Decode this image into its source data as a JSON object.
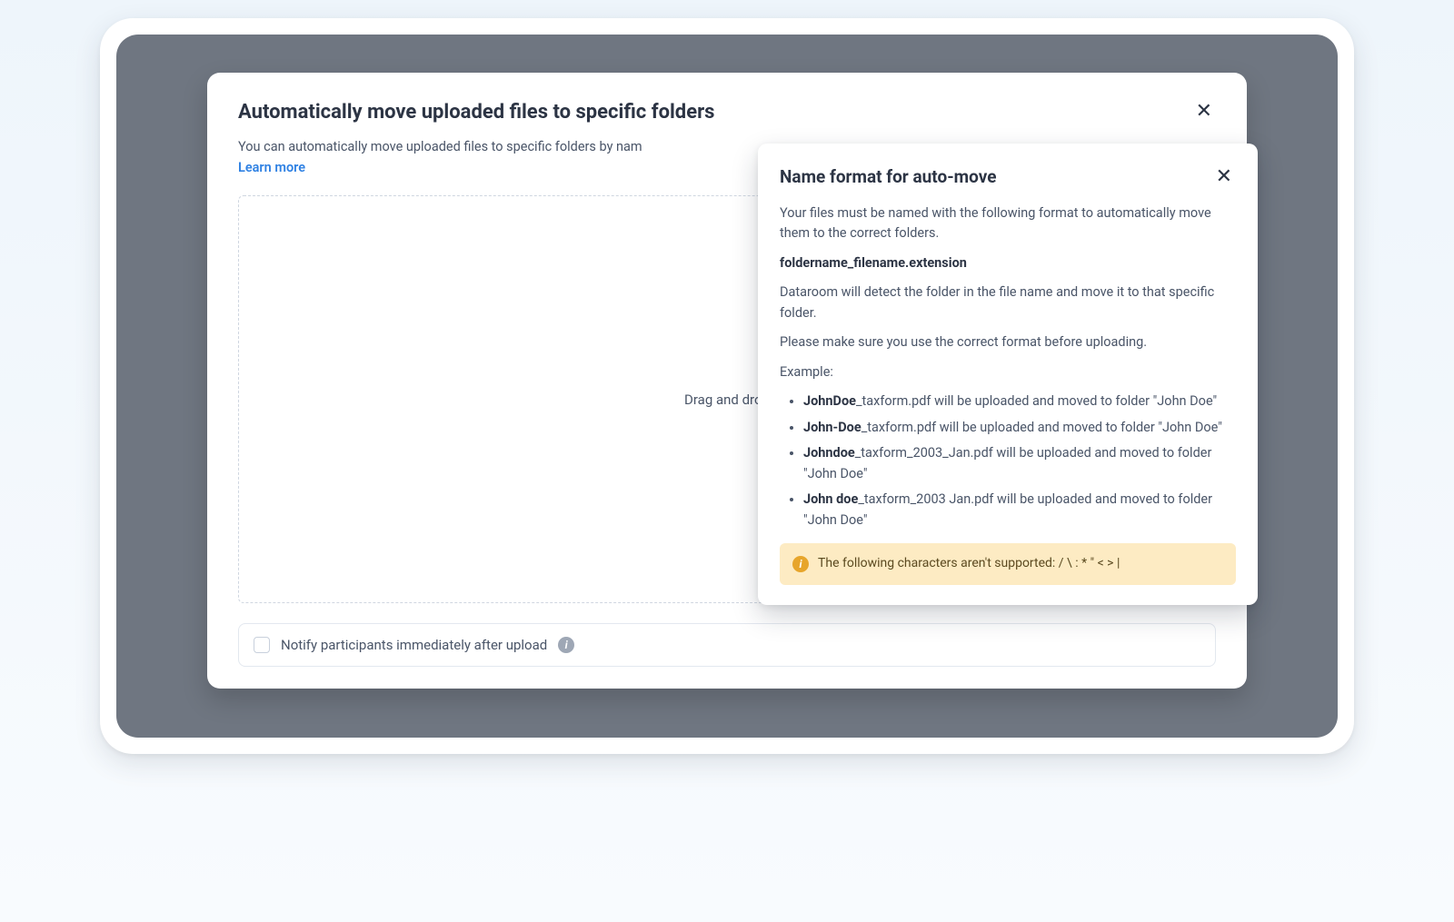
{
  "modal": {
    "title": "Automatically move uploaded files to specific folders",
    "description": "You can automatically move uploaded files to specific folders by nam",
    "learn_more": "Learn more",
    "dropzone_text": "Drag and drop",
    "notify_label": "Notify participants immediately after upload"
  },
  "popover": {
    "title": "Name format for auto-move",
    "intro": "Your files must be named with the following format to automatically move them to the correct folders.",
    "format": "foldername_filename.extension",
    "detect": "Dataroom will detect the folder in the file name and move it to that specific folder.",
    "ensure": "Please make sure you use the correct format before uploading.",
    "example_label": "Example:",
    "examples": [
      {
        "bold": "JohnDoe",
        "rest": "_taxform.pdf will be uploaded and moved to folder \"John Doe\""
      },
      {
        "bold": "John-Doe",
        "rest": "_taxform.pdf will be uploaded and moved to folder \"John Doe\""
      },
      {
        "bold": "Johndoe",
        "rest": "_taxform_2003_Jan.pdf will be uploaded and moved to folder \"John Doe\""
      },
      {
        "bold": "John doe",
        "rest": "_taxform_2003 Jan.pdf will be uploaded and moved to folder \"John Doe\""
      }
    ],
    "warning": "The following characters aren't supported: / \\ : * \" < > |"
  }
}
